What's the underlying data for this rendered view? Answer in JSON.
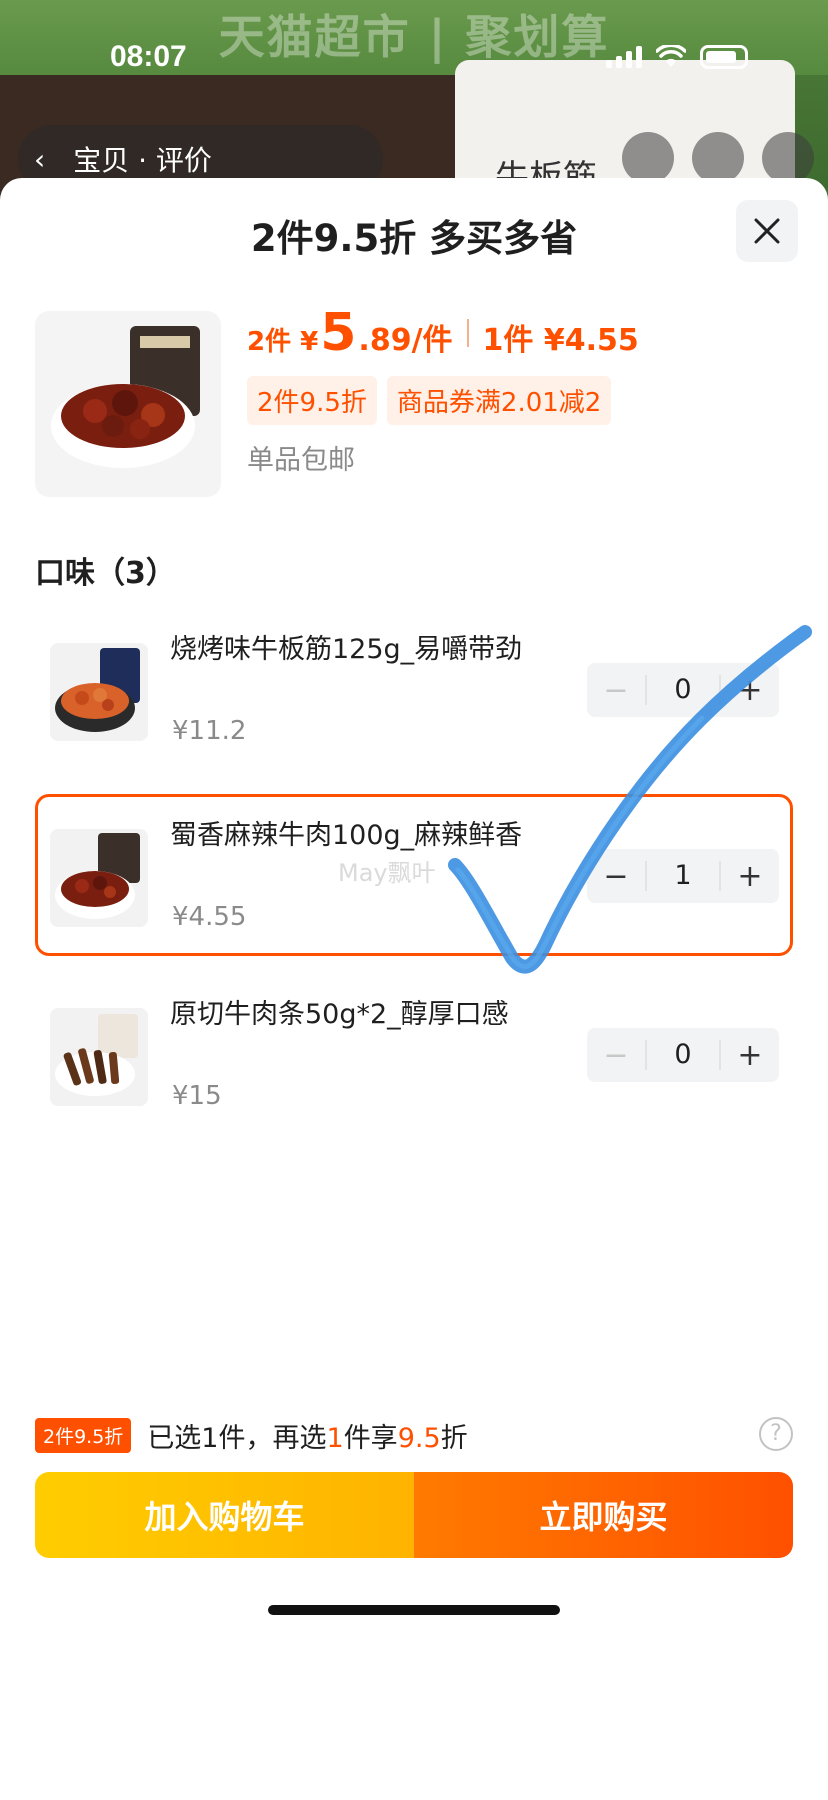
{
  "status_bar": {
    "time": "08:07"
  },
  "background": {
    "banner_text": "天猫超市 | 聚划算",
    "nav_label": "宝贝 · 评价",
    "pack_text": "牛板筋"
  },
  "sheet": {
    "title": "2件9.5折 多买多省",
    "close_icon": "close-icon"
  },
  "product": {
    "price_prefix": "2件 ¥",
    "price_big": "5",
    "price_decimal": ".89/件",
    "single_prefix": "1件 ¥4.55",
    "tags": [
      "2件9.5折",
      "商品券满2.01减2"
    ],
    "shipping": "单品包邮"
  },
  "section": {
    "title": "口味（3）"
  },
  "variants": [
    {
      "name": "烧烤味牛板筋125g_易嚼带劲",
      "price": "¥11.2",
      "qty": "0",
      "selected": false
    },
    {
      "name": "蜀香麻辣牛肉100g_麻辣鲜香",
      "price": "¥4.55",
      "qty": "1",
      "selected": true
    },
    {
      "name": "原切牛肉条50g*2_醇厚口感",
      "price": "¥15",
      "qty": "0",
      "selected": false
    }
  ],
  "watermark": "May飘叶",
  "footer": {
    "badge": "2件9.5折",
    "info_pre": "已选1件，再选",
    "info_num": "1",
    "info_mid": "件享",
    "info_discount": "9.5",
    "info_post": "折",
    "help": "?"
  },
  "actions": {
    "cart_label": "加入购物车",
    "buy_label": "立即购买"
  },
  "colors": {
    "accent": "#ff5000",
    "cart": "#ffbf00",
    "annotation": "#3a8ee0"
  }
}
